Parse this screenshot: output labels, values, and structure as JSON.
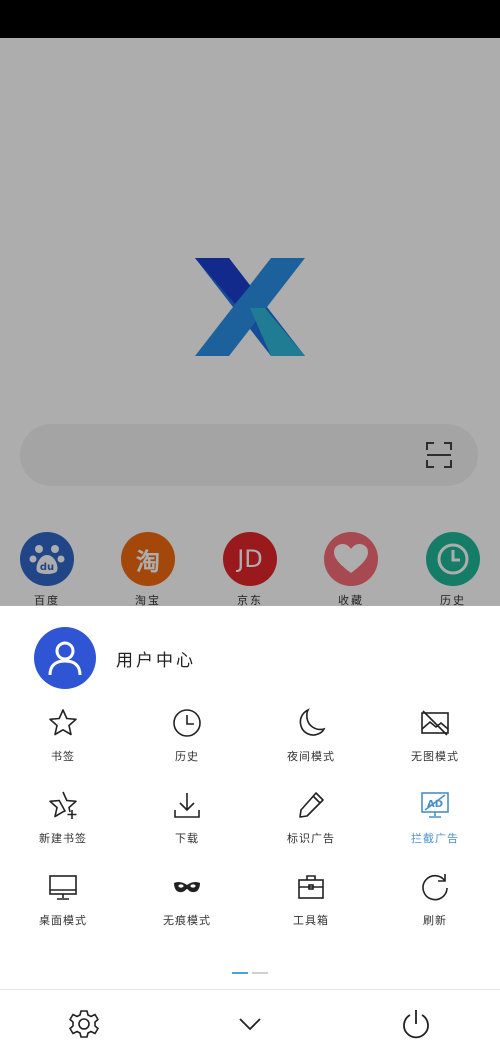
{
  "quick_links": [
    {
      "label": "百度",
      "glyph": "du",
      "color": "#3067c8",
      "icon": "baidu-paw-icon"
    },
    {
      "label": "淘宝",
      "glyph": "淘",
      "color": "#f06a0f",
      "icon": "taobao-icon"
    },
    {
      "label": "京东",
      "glyph": "JD",
      "color": "#e4262b",
      "icon": "jd-icon"
    },
    {
      "label": "收藏",
      "glyph": "",
      "color": "#f76c78",
      "icon": "heart-icon"
    },
    {
      "label": "历史",
      "glyph": "",
      "color": "#20b79a",
      "icon": "clock-icon"
    }
  ],
  "menu": {
    "user_center_label": "用户中心",
    "items": [
      {
        "label": "书签",
        "icon": "star-icon"
      },
      {
        "label": "历史",
        "icon": "history-clock-icon"
      },
      {
        "label": "夜间模式",
        "icon": "moon-icon"
      },
      {
        "label": "无图模式",
        "icon": "no-image-icon"
      },
      {
        "label": "新建书签",
        "icon": "star-plus-icon"
      },
      {
        "label": "下载",
        "icon": "download-icon"
      },
      {
        "label": "标识广告",
        "icon": "pencil-icon"
      },
      {
        "label": "拦截广告",
        "icon": "ad-block-icon",
        "active": true
      },
      {
        "label": "桌面模式",
        "icon": "desktop-icon"
      },
      {
        "label": "无痕模式",
        "icon": "mask-icon"
      },
      {
        "label": "工具箱",
        "icon": "toolbox-icon"
      },
      {
        "label": "刷新",
        "icon": "refresh-icon"
      }
    ]
  },
  "colors": {
    "accent": "#4a90c8",
    "avatar_bg": "#2f55d4"
  }
}
